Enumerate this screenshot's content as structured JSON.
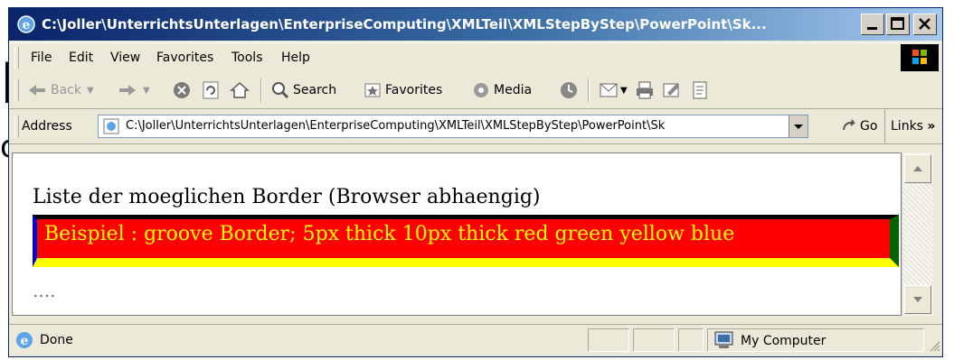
{
  "window": {
    "title": "C:\\Joller\\UnterrichtsUnterlagen\\EnterpriseComputing\\XMLTeil\\XMLStepByStep\\PowerPoint\\Sk..."
  },
  "menu": {
    "items": [
      "File",
      "Edit",
      "View",
      "Favorites",
      "Tools",
      "Help"
    ]
  },
  "toolbar": {
    "back_label": "Back",
    "search_label": "Search",
    "favorites_label": "Favorites",
    "media_label": "Media"
  },
  "address": {
    "label": "Address",
    "value": "C:\\Joller\\UnterrichtsUnterlagen\\EnterpriseComputing\\XMLTeil\\XMLStepByStep\\PowerPoint\\Sk",
    "go_label": "Go",
    "links_label": "Links"
  },
  "content": {
    "heading": "Liste der moeglichen Border (Browser abhaengig)",
    "demo_text": "Beispiel : groove Border; 5px thick 10px thick red green yellow blue",
    "dots": "....",
    "colors": {
      "background": "#ff0000",
      "text": "#ffff00",
      "top": "#000000",
      "right": "#006400",
      "bottom": "#ffff00",
      "left": "#0000c8"
    }
  },
  "status": {
    "text": "Done",
    "zone": "My Computer"
  },
  "background": {
    "glyph1": "L",
    "glyph2": "o"
  }
}
